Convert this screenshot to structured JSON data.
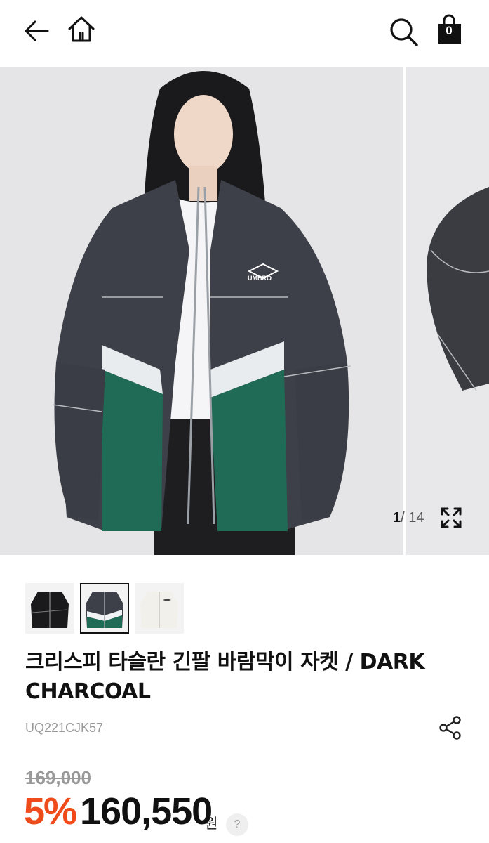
{
  "header": {
    "back_icon": "arrow-left-icon",
    "home_icon": "home-icon",
    "search_icon": "search-icon",
    "cart_icon": "shopping-bag-icon",
    "cart_count": "0"
  },
  "gallery": {
    "current": "1",
    "separator": "/",
    "total": "14",
    "expand_icon": "expand-icon",
    "logo_text": "UMBRO"
  },
  "thumbnails": [
    {
      "name": "black-jacket"
    },
    {
      "name": "charcoal-green-jacket"
    },
    {
      "name": "ivory-jacket"
    }
  ],
  "product": {
    "title": "크리스피 타슬란 긴팔 바람막이 자켓 / DARK CHARCOAL",
    "sku": "UQ221CJK57",
    "share_icon": "share-icon",
    "original_price": "169,000",
    "discount": "5%",
    "price": "160,550",
    "currency": "원",
    "help": "?"
  },
  "colors": {
    "accent": "#ee4a1a",
    "jacket_charcoal": "#3d4048",
    "jacket_green": "#1f6b55"
  }
}
